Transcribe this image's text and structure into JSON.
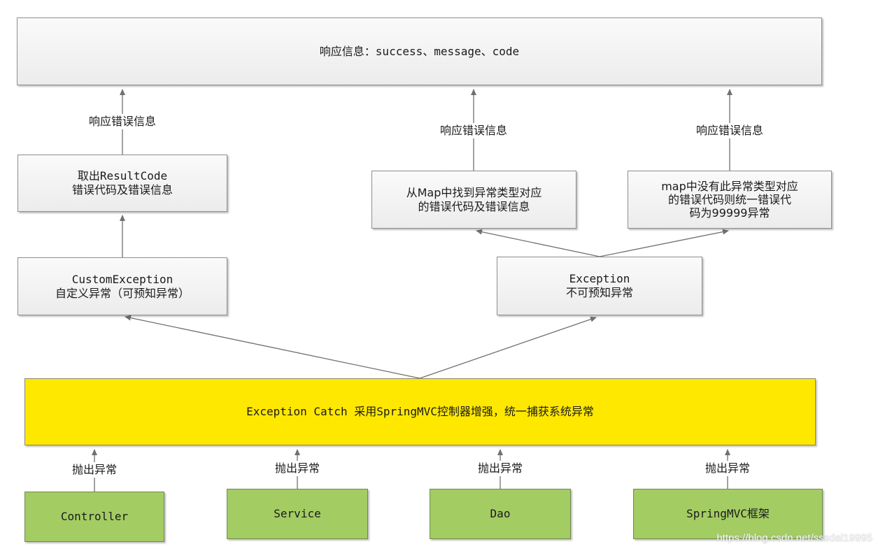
{
  "diagram": {
    "response_box": {
      "text": "响应信息：success、message、code"
    },
    "result_code_box": {
      "text": "取出ResultCode\n错误代码及错误信息"
    },
    "map_found_box": {
      "text": "从Map中找到异常类型对应\n的错误代码及错误信息"
    },
    "map_missing_box": {
      "text": "map中没有此异常类型对应\n的错误代码则统一错误代\n码为99999异常"
    },
    "custom_exception_box": {
      "text": "CustomException\n自定义异常（可预知异常）"
    },
    "exception_box": {
      "text": "Exception\n不可预知异常"
    },
    "catch_box": {
      "text": "Exception Catch 采用SpringMVC控制器增强，统一捕获系统异常"
    },
    "sources": [
      {
        "text": "Controller",
        "edge_label": "抛出异常"
      },
      {
        "text": "Service",
        "edge_label": "抛出异常"
      },
      {
        "text": "Dao",
        "edge_label": "抛出异常"
      },
      {
        "text": "SpringMVC框架",
        "edge_label": "抛出异常"
      }
    ],
    "response_edge_labels": [
      "响应错误信息",
      "响应错误信息",
      "响应错误信息"
    ],
    "colors": {
      "catch": "#ffe800",
      "source": "#a3cc63",
      "node": "#f2f2f2",
      "edge": "#707070"
    }
  },
  "watermark": "https://blog.csdn.net/sssdal19995"
}
